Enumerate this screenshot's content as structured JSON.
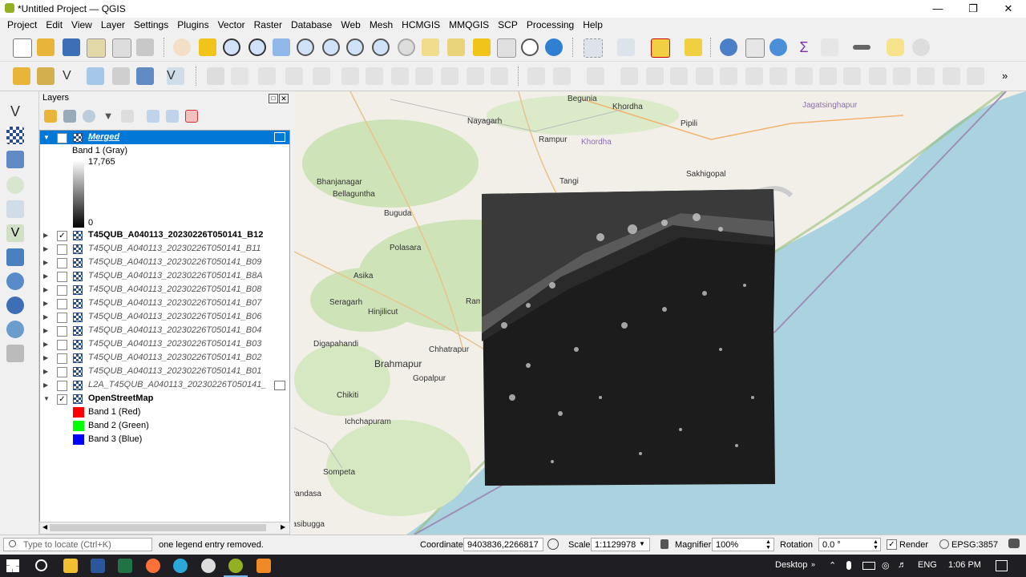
{
  "window": {
    "title": "*Untitled Project — QGIS"
  },
  "menu": [
    "Project",
    "Edit",
    "View",
    "Layer",
    "Settings",
    "Plugins",
    "Vector",
    "Raster",
    "Database",
    "Web",
    "Mesh",
    "HCMGIS",
    "MMQGIS",
    "SCP",
    "Processing",
    "Help"
  ],
  "layers_panel": {
    "title": "Layers",
    "items": [
      {
        "name": "Merged",
        "checked": false,
        "expanded": true,
        "selected": true
      },
      {
        "name": "T45QUB_A040113_20230226T050141_B12",
        "checked": true
      },
      {
        "name": "T45QUB_A040113_20230226T050141_B11",
        "checked": false
      },
      {
        "name": "T45QUB_A040113_20230226T050141_B09",
        "checked": false
      },
      {
        "name": "T45QUB_A040113_20230226T050141_B8A",
        "checked": false
      },
      {
        "name": "T45QUB_A040113_20230226T050141_B08",
        "checked": false
      },
      {
        "name": "T45QUB_A040113_20230226T050141_B07",
        "checked": false
      },
      {
        "name": "T45QUB_A040113_20230226T050141_B06",
        "checked": false
      },
      {
        "name": "T45QUB_A040113_20230226T050141_B04",
        "checked": false
      },
      {
        "name": "T45QUB_A040113_20230226T050141_B03",
        "checked": false
      },
      {
        "name": "T45QUB_A040113_20230226T050141_B02",
        "checked": false
      },
      {
        "name": "T45QUB_A040113_20230226T050141_B01",
        "checked": false
      },
      {
        "name": "L2A_T45QUB_A040113_20230226T050141_",
        "checked": false
      },
      {
        "name": "OpenStreetMap",
        "checked": true,
        "expanded": true
      }
    ],
    "merged_legend": {
      "band": "Band 1 (Gray)",
      "max": "17,765",
      "min": "0"
    },
    "osm_legend": [
      {
        "label": "Band 1 (Red)",
        "color": "#ff0000"
      },
      {
        "label": "Band 2 (Green)",
        "color": "#00ff00"
      },
      {
        "label": "Band 3 (Blue)",
        "color": "#0000ff"
      }
    ]
  },
  "map_labels": [
    "Begunia",
    "Khordha",
    "Jagatsinghapur",
    "Nayagarh",
    "Pipili",
    "Rampur",
    "Khordha",
    "Sakhigopal",
    "Tangi",
    "Bhanjanagar",
    "Bellaguntha",
    "Buguda",
    "Polasara",
    "Asika",
    "Seragarh",
    "Hinjilicut",
    "Rambha",
    "Digapahandi",
    "Chhatrapur",
    "Brahmapur",
    "Gopalpur",
    "Chikiti",
    "Ichchapuram",
    "Sompeta",
    "Pandasa",
    "Palasibugga"
  ],
  "status": {
    "locate_placeholder": "Type to locate (Ctrl+K)",
    "message": "one legend entry removed.",
    "coordinate_label": "Coordinate",
    "coordinate": "9403836,2266817",
    "scale_label": "Scale",
    "scale": "1:1129978",
    "magnifier_label": "Magnifier",
    "magnifier": "100%",
    "rotation_label": "Rotation",
    "rotation": "0.0 °",
    "render_label": "Render",
    "crs": "EPSG:3857"
  },
  "taskbar": {
    "desktop": "Desktop",
    "lang": "ENG",
    "time": "1:06 PM"
  }
}
